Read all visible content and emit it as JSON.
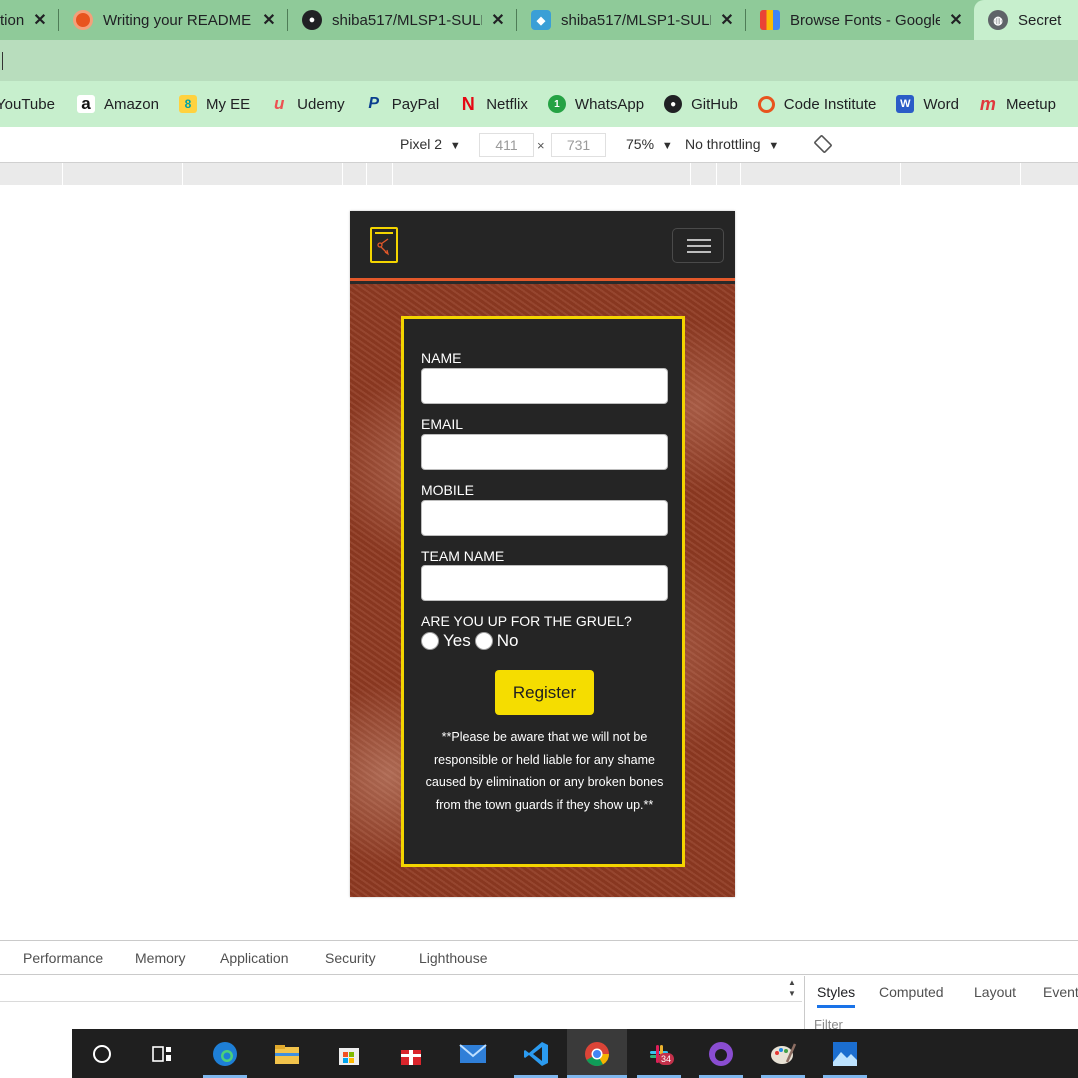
{
  "browser": {
    "tabs": [
      {
        "title": "tion",
        "icon": "page-icon"
      },
      {
        "title": "Writing your README",
        "icon": "code-institute-icon"
      },
      {
        "title": "shiba517/MLSP1-SULF",
        "icon": "github-icon"
      },
      {
        "title": "shiba517/MLSP1-SULF",
        "icon": "cube-icon"
      },
      {
        "title": "Browse Fonts - Google",
        "icon": "google-fonts-icon"
      },
      {
        "title": "Secret",
        "icon": "globe-icon"
      }
    ],
    "bookmarks": [
      "YouTube",
      "Amazon",
      "My EE",
      "Udemy",
      "PayPal",
      "Netflix",
      "WhatsApp",
      "GitHub",
      "Code Institute",
      "Word",
      "Meetup"
    ]
  },
  "device_toolbar": {
    "device": "Pixel 2",
    "width": "411",
    "times": "×",
    "height": "731",
    "zoom": "75%",
    "throttling": "No throttling"
  },
  "site": {
    "form": {
      "name_label": "NAME",
      "email_label": "EMAIL",
      "mobile_label": "MOBILE",
      "team_label": "TEAM NAME",
      "question": "ARE YOU UP FOR THE GRUEL?",
      "yes_label": "Yes",
      "no_label": "No",
      "register_label": "Register",
      "disclaimer": "**Please be aware that we will not be responsible or held liable for any shame caused by elimination or any broken bones from the town guards if they show up.**"
    }
  },
  "devtools": {
    "tabs": [
      "Performance",
      "Memory",
      "Application",
      "Security",
      "Lighthouse"
    ],
    "side_tabs": [
      "Styles",
      "Computed",
      "Layout",
      "Event"
    ],
    "filter_placeholder": "Filter"
  },
  "taskbar": {
    "apps": [
      "cortana-icon",
      "task-view-icon",
      "edge-icon",
      "file-explorer-icon",
      "store-icon",
      "gift-icon",
      "mail-icon",
      "vscode-icon",
      "chrome-icon",
      "slack-icon",
      "github-desktop-icon",
      "paint-icon",
      "photos-icon"
    ],
    "slack_badge": "34"
  },
  "colors": {
    "accent": "#f3d400",
    "nav_border": "#e2582a",
    "hero": "#8f3a22"
  }
}
